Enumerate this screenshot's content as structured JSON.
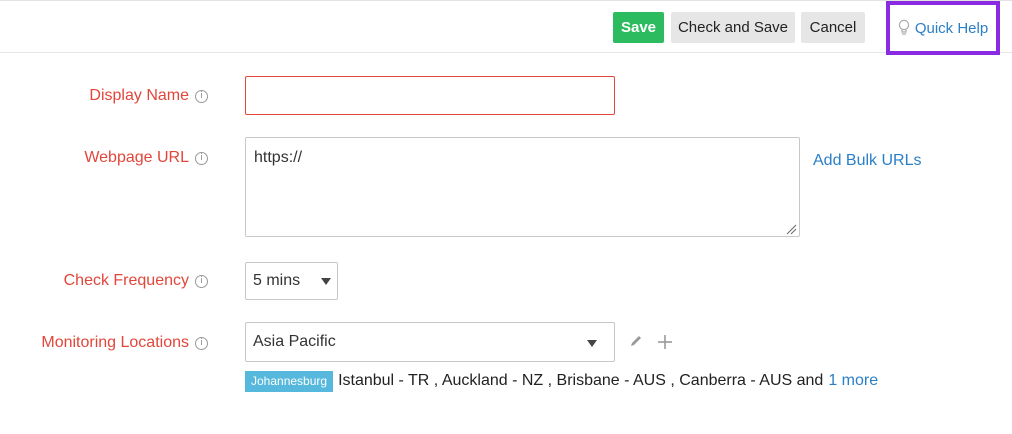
{
  "toolbar": {
    "save_label": "Save",
    "check_save_label": "Check and Save",
    "cancel_label": "Cancel",
    "quick_help_label": "Quick Help"
  },
  "form": {
    "display_name": {
      "label": "Display Name",
      "value": ""
    },
    "webpage_url": {
      "label": "Webpage URL",
      "value": "https://"
    },
    "add_bulk_urls": "Add Bulk URLs",
    "check_frequency": {
      "label": "Check Frequency",
      "selected": "5 mins"
    },
    "monitoring_locations": {
      "label": "Monitoring Locations",
      "selected": "Asia Pacific",
      "primary_location": "Johannesburg",
      "other_locations": "Istanbul - TR , Auckland - NZ , Brisbane - AUS , Canberra - AUS and",
      "more_link": "1 more"
    }
  },
  "colors": {
    "label_red": "#e2463b",
    "save_green": "#2dbb5f",
    "link_blue": "#2b7fc7",
    "highlight_purple": "#8a2be2",
    "tag_blue": "#56b8dc"
  },
  "icons": [
    "lightbulb-icon",
    "info-icon",
    "chevron-down-icon",
    "pencil-icon",
    "plus-icon",
    "resize-grip-icon"
  ]
}
